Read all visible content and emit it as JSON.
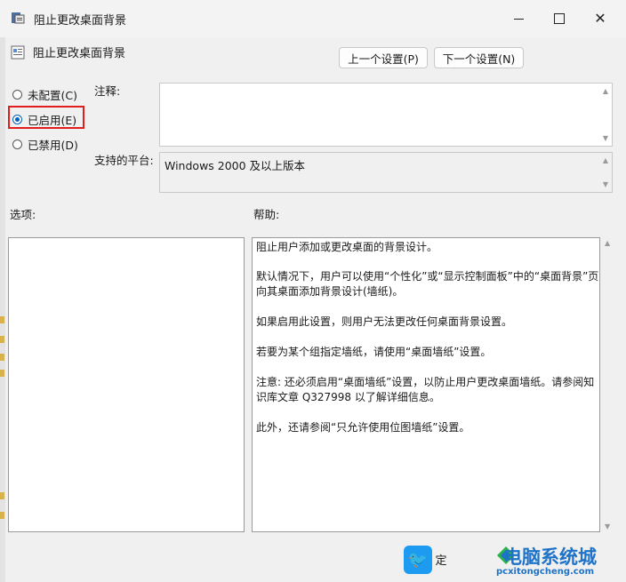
{
  "window": {
    "title": "阻止更改桌面背景",
    "icon": "policy-icon",
    "controls": [
      "minimize-icon",
      "maximize-icon",
      "close-icon"
    ]
  },
  "policy": {
    "name": "阻止更改桌面背景"
  },
  "nav": {
    "prev_label": "上一个设置(P)",
    "next_label": "下一个设置(N)"
  },
  "state": {
    "options": [
      {
        "label": "未配置(C)",
        "checked": false
      },
      {
        "label": "已启用(E)",
        "checked": true
      },
      {
        "label": "已禁用(D)",
        "checked": false
      }
    ]
  },
  "comment": {
    "label": "注释:",
    "value": ""
  },
  "platform": {
    "label": "支持的平台:",
    "value": "Windows 2000 及以上版本"
  },
  "options_label": "选项:",
  "help": {
    "label": "帮助:",
    "paragraphs": [
      "阻止用户添加或更改桌面的背景设计。",
      "默认情况下，用户可以使用“个性化”或“显示控制面板”中的“桌面背景”页向其桌面添加背景设计(墙纸)。",
      "如果启用此设置，则用户无法更改任何桌面背景设置。",
      "若要为某个组指定墙纸，请使用“桌面墙纸”设置。",
      "注意: 还必须启用“桌面墙纸”设置，以防止用户更改桌面墙纸。请参阅知识库文章 Q327998 以了解详细信息。",
      "此外，还请参阅“只允许使用位图墙纸”设置。"
    ]
  },
  "footer": {
    "ok_label": "定"
  },
  "watermark": {
    "text": "电脑系统城",
    "url": "pcxitongcheng.com"
  },
  "colors": {
    "accent": "#005fb8",
    "highlight": "#e01e1e",
    "brand": "#1e73c8"
  }
}
